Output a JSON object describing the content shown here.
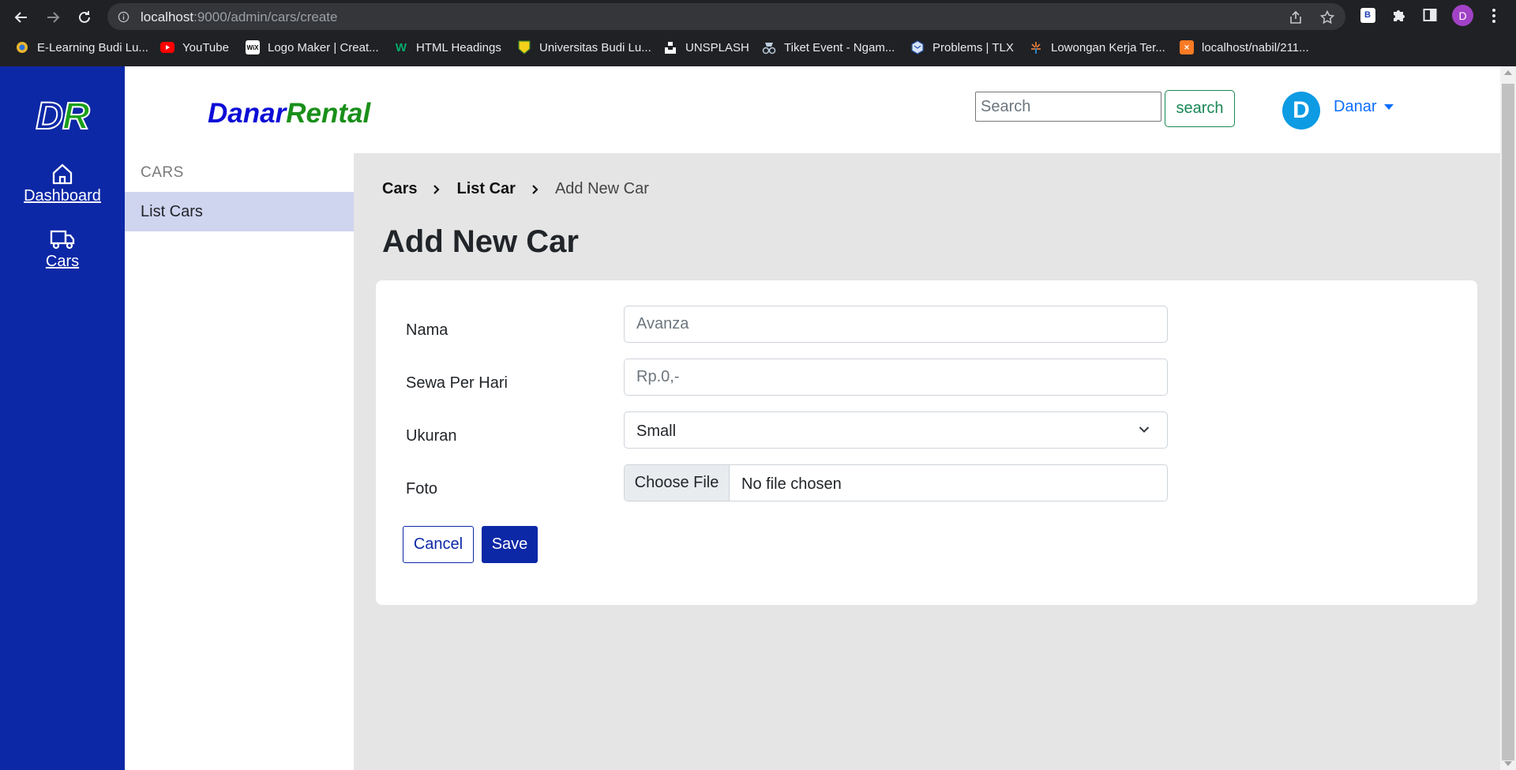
{
  "browser": {
    "url_host": "localhost",
    "url_path": ":9000/admin/cars/create",
    "profile_initial": "D",
    "bookmarks": [
      {
        "label": "E-Learning Budi Lu...",
        "icon": "elearning-favicon"
      },
      {
        "label": "YouTube",
        "icon": "youtube-favicon"
      },
      {
        "label": "Logo Maker | Creat...",
        "icon": "wix-favicon"
      },
      {
        "label": "HTML Headings",
        "icon": "w3schools-favicon"
      },
      {
        "label": "Universitas Budi Lu...",
        "icon": "university-favicon"
      },
      {
        "label": "UNSPLASH",
        "icon": "unsplash-favicon"
      },
      {
        "label": "Tiket Event - Ngam...",
        "icon": "ticket-favicon"
      },
      {
        "label": "Problems | TLX",
        "icon": "tlx-favicon"
      },
      {
        "label": "Lowongan Kerja Ter...",
        "icon": "jobs-favicon"
      },
      {
        "label": "localhost/nabil/211...",
        "icon": "xampp-favicon"
      }
    ]
  },
  "rail": {
    "logo_d": "D",
    "logo_r": "R",
    "items": [
      {
        "label": "Dashboard",
        "icon": "home-icon"
      },
      {
        "label": "Cars",
        "icon": "truck-icon"
      }
    ]
  },
  "header": {
    "brand_part1": "Danar",
    "brand_part2": "Rental",
    "search_placeholder": "Search",
    "search_button": "search",
    "avatar_initial": "D",
    "user_name": "Danar"
  },
  "sidebar": {
    "heading": "CARS",
    "items": [
      {
        "label": "List Cars",
        "active": true
      }
    ]
  },
  "main": {
    "breadcrumb": {
      "first": "Cars",
      "second": "List Car",
      "current": "Add New Car"
    },
    "title": "Add New Car",
    "form": {
      "nama_label": "Nama",
      "nama_placeholder": "Avanza",
      "sewa_label": "Sewa Per Hari",
      "sewa_placeholder": "Rp.0,-",
      "ukuran_label": "Ukuran",
      "ukuran_value": "Small",
      "foto_label": "Foto",
      "choose_file": "Choose File",
      "no_file": "No file chosen"
    },
    "cancel_button": "Cancel",
    "save_button": "Save"
  },
  "colors": {
    "rail_bg": "#0d28a6",
    "active_item_bg": "#cfd4ef",
    "content_bg": "#e5e5e5",
    "brand_blue": "#0d0dd6",
    "brand_green": "#1a8f1a",
    "link_blue": "#0d6efd",
    "search_green": "#198754"
  }
}
